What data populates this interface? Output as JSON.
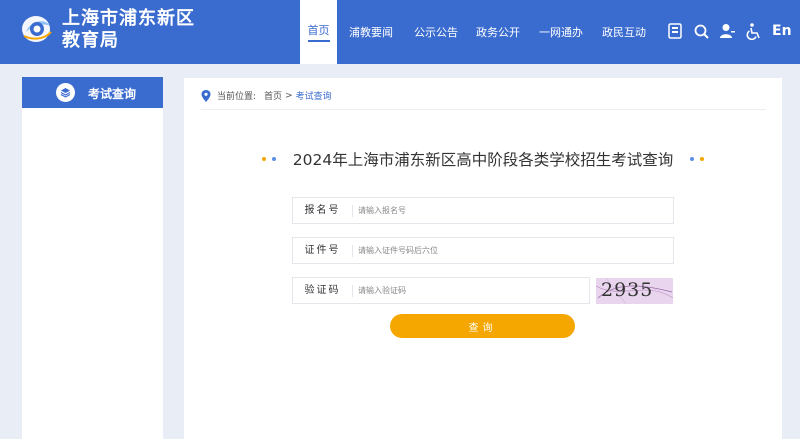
{
  "header": {
    "brand_line1": "上海市浦东新区",
    "brand_line2": "教育局",
    "nav": [
      {
        "label": "首页",
        "active": true
      },
      {
        "label": "浦教要闻",
        "active": false
      },
      {
        "label": "公示公告",
        "active": false
      },
      {
        "label": "政务公开",
        "active": false
      },
      {
        "label": "一网通办",
        "active": false
      },
      {
        "label": "政民互动",
        "active": false
      }
    ],
    "tools": [
      "barrier-free-icon",
      "search-icon",
      "user-icon",
      "accessibility-icon"
    ],
    "lang_label": "En"
  },
  "sidebar": {
    "title": "考试查询",
    "icon": "layers-icon"
  },
  "breadcrumb": {
    "prefix": "当前位置:",
    "home": "首页",
    "separator": ">",
    "current": "考试查询"
  },
  "page": {
    "title": "2024年上海市浦东新区高中阶段各类学校招生考试查询"
  },
  "form": {
    "fields": [
      {
        "label": "报名号",
        "placeholder": "请输入报名号"
      },
      {
        "label": "证件号",
        "placeholder": "请输入证件号码后六位"
      },
      {
        "label": "验证码",
        "placeholder": "请输入验证码"
      }
    ],
    "captcha_text": "2935",
    "submit_label": "查询"
  },
  "colors": {
    "primary": "#3a6bcf",
    "accent": "#f5a700",
    "dot_blue": "#5b8fe6",
    "dot_orange": "#f5a700"
  }
}
